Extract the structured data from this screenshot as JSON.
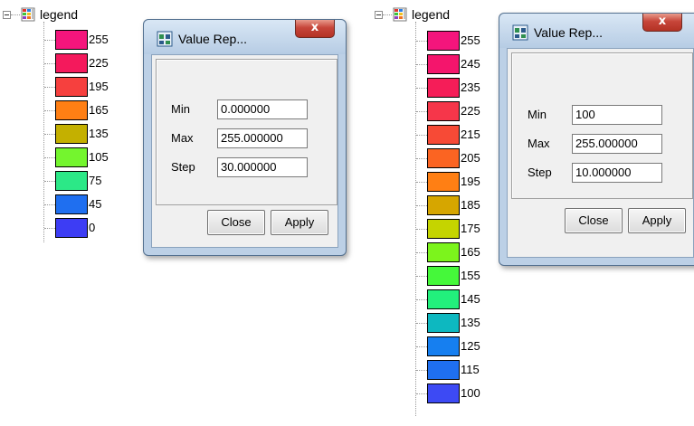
{
  "left_legend": {
    "title": "legend",
    "items": [
      {
        "label": "255",
        "color": "#f4157c"
      },
      {
        "label": "225",
        "color": "#f4195c"
      },
      {
        "label": "195",
        "color": "#f6403e"
      },
      {
        "label": "165",
        "color": "#ff7f14"
      },
      {
        "label": "135",
        "color": "#c4b000"
      },
      {
        "label": "105",
        "color": "#74f52e"
      },
      {
        "label": "75",
        "color": "#2ce887"
      },
      {
        "label": "45",
        "color": "#1f6ff0"
      },
      {
        "label": "0",
        "color": "#3d3df4"
      }
    ]
  },
  "right_legend": {
    "title": "legend",
    "items": [
      {
        "label": "255",
        "color": "#f4157c"
      },
      {
        "label": "245",
        "color": "#f4156c"
      },
      {
        "label": "235",
        "color": "#f51d58"
      },
      {
        "label": "225",
        "color": "#f6364a"
      },
      {
        "label": "215",
        "color": "#f74a36"
      },
      {
        "label": "205",
        "color": "#fb6422"
      },
      {
        "label": "195",
        "color": "#ff7f14"
      },
      {
        "label": "185",
        "color": "#d6a600"
      },
      {
        "label": "175",
        "color": "#c5d400"
      },
      {
        "label": "165",
        "color": "#7cf41c"
      },
      {
        "label": "155",
        "color": "#45f83a"
      },
      {
        "label": "145",
        "color": "#22f07c"
      },
      {
        "label": "135",
        "color": "#0db8c0"
      },
      {
        "label": "125",
        "color": "#167ff0"
      },
      {
        "label": "115",
        "color": "#1f6ff0"
      },
      {
        "label": "100",
        "color": "#3d4af4"
      }
    ]
  },
  "dialog_left": {
    "title": "Value Rep...",
    "close_glyph": "x",
    "min_label": "Min",
    "min_value": "0.000000",
    "max_label": "Max",
    "max_value": "255.000000",
    "step_label": "Step",
    "step_value": "30.000000",
    "close_button": "Close",
    "apply_button": "Apply"
  },
  "dialog_right": {
    "title": "Value Rep...",
    "close_glyph": "x",
    "min_label": "Min",
    "min_value": "100",
    "max_label": "Max",
    "max_value": "255.000000",
    "step_label": "Step",
    "step_value": "10.000000",
    "close_button": "Close",
    "apply_button": "Apply"
  }
}
